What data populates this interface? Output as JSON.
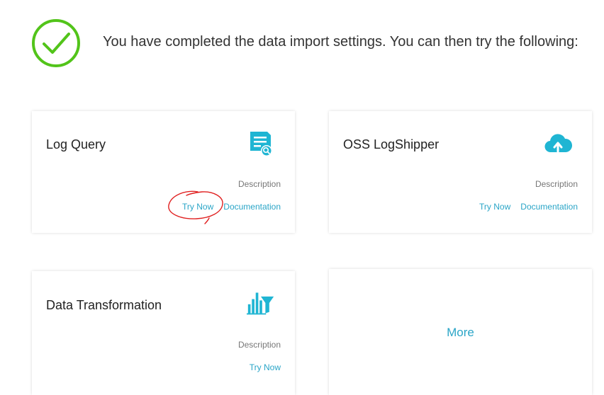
{
  "header": {
    "message": "You have completed the data import settings. You can then try the following:",
    "success_color": "#52c41a"
  },
  "accent_color": "#2aa5c7",
  "cards": [
    {
      "title": "Log Query",
      "icon": "log-search-icon",
      "description_label": "Description",
      "try_now_label": "Try Now",
      "documentation_label": "Documentation"
    },
    {
      "title": "OSS LogShipper",
      "icon": "cloud-upload-icon",
      "description_label": "Description",
      "try_now_label": "Try Now",
      "documentation_label": "Documentation"
    },
    {
      "title": "Data Transformation",
      "icon": "chart-filter-icon",
      "description_label": "Description",
      "try_now_label": "Try Now"
    },
    {
      "more_label": "More"
    }
  ],
  "annotation": {
    "type": "hand-drawn-circle",
    "color": "#e02020",
    "target": "Try Now"
  }
}
